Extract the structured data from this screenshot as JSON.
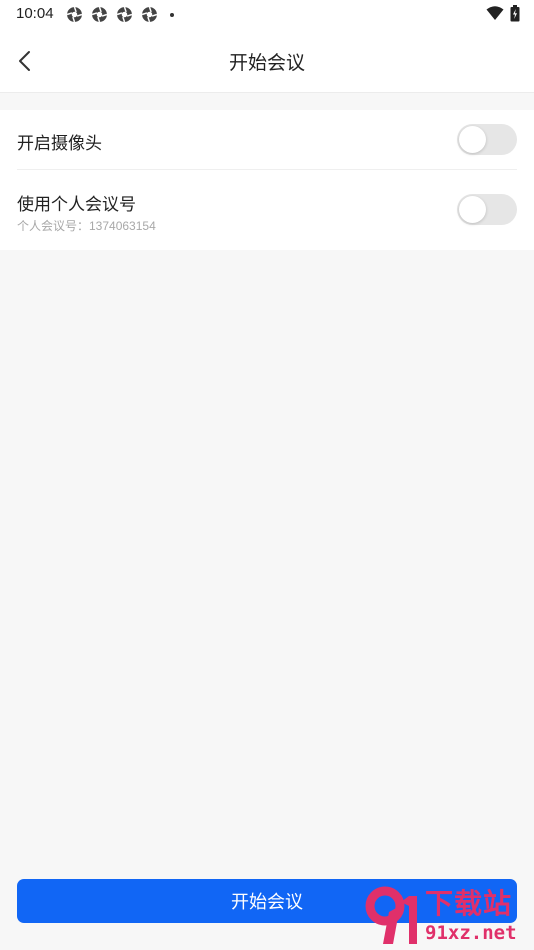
{
  "status_bar": {
    "time": "10:04",
    "notification_icons": [
      "aperture-icon",
      "aperture-icon",
      "aperture-icon",
      "aperture-icon"
    ],
    "system_icons": [
      "wifi-icon",
      "battery-charging-icon"
    ]
  },
  "nav": {
    "title": "开始会议",
    "back_icon": "chevron-left-icon"
  },
  "settings": {
    "camera": {
      "label": "开启摄像头",
      "enabled": false
    },
    "personal_meeting_id": {
      "label": "使用个人会议号",
      "sublabel": "个人会议号：1374063154",
      "enabled": false
    }
  },
  "actions": {
    "start_meeting_label": "开始会议"
  },
  "watermark": {
    "cn_text": "下载站",
    "url_text": "91xz.net"
  },
  "colors": {
    "accent": "#1166f5",
    "toggle_off": "#e6e6e6",
    "background": "#f7f7f7",
    "watermark": "#e0306a"
  }
}
